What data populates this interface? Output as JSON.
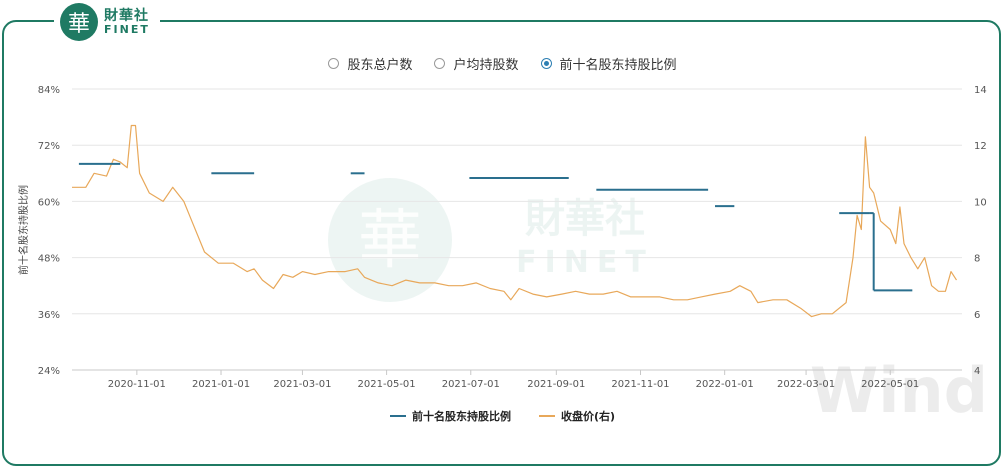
{
  "brand": {
    "logo_char": "華",
    "name_cn": "財華社",
    "name_en": "FINET",
    "watermark_en": "FINET",
    "wind": "Wind"
  },
  "selectors": [
    {
      "label": "股东总户数",
      "selected": false
    },
    {
      "label": "户均持股数",
      "selected": false
    },
    {
      "label": "前十名股东持股比例",
      "selected": true
    }
  ],
  "colors": {
    "frame": "#1f7a63",
    "ratio": "#2a6f8e",
    "price": "#e8a85a",
    "grid": "#e6e6e6",
    "radio_on": "#2d7fb3"
  },
  "chart_data": {
    "type": "line",
    "ylabel": "前十名股东持股比例",
    "x_ticks": [
      "2020-11-01",
      "2021-01-01",
      "2021-03-01",
      "2021-05-01",
      "2021-07-01",
      "2021-09-01",
      "2021-11-01",
      "2022-01-01",
      "2022-03-01",
      "2022-05-01"
    ],
    "x_range": [
      "2020-09-15",
      "2022-06-22"
    ],
    "y_left": {
      "range": [
        24,
        84
      ],
      "ticks": [
        "24%",
        "36%",
        "48%",
        "60%",
        "72%",
        "84%"
      ],
      "values": [
        24,
        36,
        48,
        60,
        72,
        84
      ]
    },
    "y_right": {
      "range": [
        4,
        14
      ],
      "ticks": [
        "4",
        "6",
        "8",
        "10",
        "12",
        "14"
      ],
      "values": [
        4,
        6,
        8,
        10,
        12,
        14
      ]
    },
    "series": [
      {
        "name": "前十名股东持股比例",
        "axis": "left",
        "segments": [
          {
            "start": "2020-09-20",
            "end": "2020-10-20",
            "value": 68.0
          },
          {
            "start": "2020-12-25",
            "end": "2021-01-25",
            "value": 66.0
          },
          {
            "start": "2021-04-05",
            "end": "2021-04-15",
            "value": 66.0
          },
          {
            "start": "2021-06-30",
            "end": "2021-09-10",
            "value": 65.0
          },
          {
            "start": "2021-09-30",
            "end": "2021-12-20",
            "value": 62.5
          },
          {
            "start": "2021-12-25",
            "end": "2022-01-08",
            "value": 59.0
          },
          {
            "start": "2022-03-25",
            "end": "2022-04-16",
            "value": 57.5
          },
          {
            "start": "2022-04-16",
            "end": "2022-04-19",
            "value": 57.5,
            "drop_to": 41.0
          },
          {
            "start": "2022-04-19",
            "end": "2022-05-17",
            "value": 41.0
          }
        ]
      },
      {
        "name": "收盘价(右)",
        "axis": "right",
        "points": [
          [
            "2020-09-15",
            10.5
          ],
          [
            "2020-09-25",
            10.5
          ],
          [
            "2020-10-01",
            11.0
          ],
          [
            "2020-10-10",
            10.9
          ],
          [
            "2020-10-15",
            11.5
          ],
          [
            "2020-10-20",
            11.4
          ],
          [
            "2020-10-25",
            11.2
          ],
          [
            "2020-10-28",
            12.7
          ],
          [
            "2020-10-31",
            12.7
          ],
          [
            "2020-11-03",
            11.0
          ],
          [
            "2020-11-10",
            10.3
          ],
          [
            "2020-11-20",
            10.0
          ],
          [
            "2020-11-27",
            10.5
          ],
          [
            "2020-12-05",
            10.0
          ],
          [
            "2020-12-10",
            9.4
          ],
          [
            "2020-12-20",
            8.2
          ],
          [
            "2020-12-30",
            7.8
          ],
          [
            "2021-01-10",
            7.8
          ],
          [
            "2021-01-20",
            7.5
          ],
          [
            "2021-01-25",
            7.6
          ],
          [
            "2021-01-31",
            7.2
          ],
          [
            "2021-02-08",
            6.9
          ],
          [
            "2021-02-15",
            7.4
          ],
          [
            "2021-02-22",
            7.3
          ],
          [
            "2021-03-01",
            7.5
          ],
          [
            "2021-03-10",
            7.4
          ],
          [
            "2021-03-20",
            7.5
          ],
          [
            "2021-04-01",
            7.5
          ],
          [
            "2021-04-10",
            7.6
          ],
          [
            "2021-04-15",
            7.3
          ],
          [
            "2021-04-25",
            7.1
          ],
          [
            "2021-05-05",
            7.0
          ],
          [
            "2021-05-15",
            7.2
          ],
          [
            "2021-05-25",
            7.1
          ],
          [
            "2021-06-05",
            7.1
          ],
          [
            "2021-06-15",
            7.0
          ],
          [
            "2021-06-25",
            7.0
          ],
          [
            "2021-07-05",
            7.1
          ],
          [
            "2021-07-15",
            6.9
          ],
          [
            "2021-07-25",
            6.8
          ],
          [
            "2021-07-30",
            6.5
          ],
          [
            "2021-08-05",
            6.9
          ],
          [
            "2021-08-15",
            6.7
          ],
          [
            "2021-08-25",
            6.6
          ],
          [
            "2021-09-05",
            6.7
          ],
          [
            "2021-09-15",
            6.8
          ],
          [
            "2021-09-25",
            6.7
          ],
          [
            "2021-10-05",
            6.7
          ],
          [
            "2021-10-15",
            6.8
          ],
          [
            "2021-10-25",
            6.6
          ],
          [
            "2021-11-05",
            6.6
          ],
          [
            "2021-11-15",
            6.6
          ],
          [
            "2021-11-25",
            6.5
          ],
          [
            "2021-12-05",
            6.5
          ],
          [
            "2021-12-15",
            6.6
          ],
          [
            "2021-12-25",
            6.7
          ],
          [
            "2022-01-05",
            6.8
          ],
          [
            "2022-01-12",
            7.0
          ],
          [
            "2022-01-20",
            6.8
          ],
          [
            "2022-01-25",
            6.4
          ],
          [
            "2022-02-05",
            6.5
          ],
          [
            "2022-02-15",
            6.5
          ],
          [
            "2022-02-25",
            6.2
          ],
          [
            "2022-03-05",
            5.9
          ],
          [
            "2022-03-12",
            6.0
          ],
          [
            "2022-03-20",
            6.0
          ],
          [
            "2022-03-30",
            6.4
          ],
          [
            "2022-04-04",
            8.0
          ],
          [
            "2022-04-07",
            9.5
          ],
          [
            "2022-04-10",
            9.0
          ],
          [
            "2022-04-13",
            12.3
          ],
          [
            "2022-04-16",
            10.5
          ],
          [
            "2022-04-19",
            10.3
          ],
          [
            "2022-04-24",
            9.3
          ],
          [
            "2022-05-01",
            9.0
          ],
          [
            "2022-05-05",
            8.5
          ],
          [
            "2022-05-08",
            9.8
          ],
          [
            "2022-05-11",
            8.5
          ],
          [
            "2022-05-16",
            8.0
          ],
          [
            "2022-05-21",
            7.6
          ],
          [
            "2022-05-26",
            8.0
          ],
          [
            "2022-05-31",
            7.0
          ],
          [
            "2022-06-05",
            6.8
          ],
          [
            "2022-06-10",
            6.8
          ],
          [
            "2022-06-14",
            7.5
          ],
          [
            "2022-06-18",
            7.2
          ]
        ]
      }
    ]
  }
}
